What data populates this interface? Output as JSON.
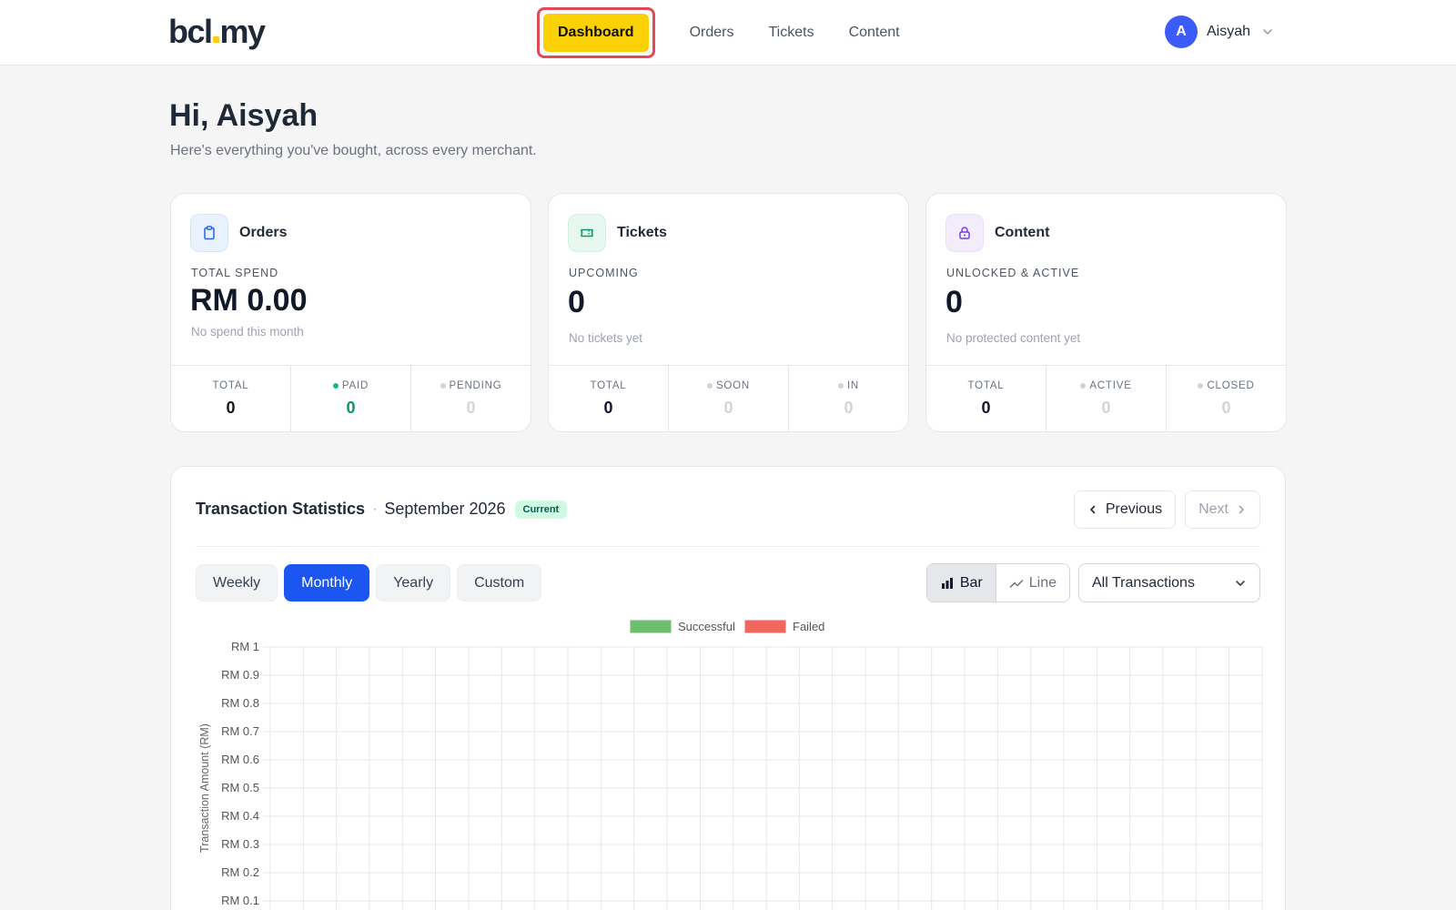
{
  "brand": {
    "logo_left": "bcl",
    "logo_right": "my"
  },
  "nav": {
    "items": [
      "Dashboard",
      "Orders",
      "Tickets",
      "Content"
    ],
    "active": "Dashboard"
  },
  "user": {
    "initial": "A",
    "name": "Aisyah"
  },
  "greeting": {
    "title": "Hi, Aisyah",
    "subtitle": "Here's everything you've bought, across every merchant."
  },
  "cards": [
    {
      "title": "Orders",
      "icon": "clipboard-icon",
      "label": "TOTAL SPEND",
      "value": "RM 0.00",
      "sub": "No spend this month",
      "stats": [
        {
          "label": "TOTAL",
          "value": "0",
          "dot": null
        },
        {
          "label": "PAID",
          "value": "0",
          "dot": "#10b981"
        },
        {
          "label": "PENDING",
          "value": "0",
          "dot": "#d1d5db"
        }
      ]
    },
    {
      "title": "Tickets",
      "icon": "ticket-icon",
      "label": "UPCOMING",
      "value": "0",
      "sub": "No tickets yet",
      "stats": [
        {
          "label": "TOTAL",
          "value": "0",
          "dot": null
        },
        {
          "label": "SOON",
          "value": "0",
          "dot": "#d1d5db"
        },
        {
          "label": "IN",
          "value": "0",
          "dot": "#d1d5db"
        }
      ]
    },
    {
      "title": "Content",
      "icon": "lock-icon",
      "label": "UNLOCKED & ACTIVE",
      "value": "0",
      "sub": "No protected content yet",
      "stats": [
        {
          "label": "TOTAL",
          "value": "0",
          "dot": null
        },
        {
          "label": "ACTIVE",
          "value": "0",
          "dot": "#d1d5db"
        },
        {
          "label": "CLOSED",
          "value": "0",
          "dot": "#d1d5db"
        }
      ]
    }
  ],
  "transactions": {
    "title": "Transaction Statistics",
    "separator": "·",
    "month": "September 2026",
    "badge": "Current",
    "previous_label": "Previous",
    "next_label": "Next",
    "periods": [
      "Weekly",
      "Monthly",
      "Yearly",
      "Custom"
    ],
    "active_period": "Monthly",
    "chart_types": [
      "Bar",
      "Line"
    ],
    "active_chart_type": "Bar",
    "filter_value": "All Transactions"
  },
  "colors": {
    "accent_yellow": "#fad104",
    "primary_blue": "#1c56f0",
    "successful": "#6dbf6f",
    "failed": "#f0675e"
  },
  "chart_data": {
    "type": "bar",
    "ylabel": "Transaction Amount (RM)",
    "ylim": [
      0,
      1
    ],
    "y_ticks": [
      "RM 1",
      "RM 0.9",
      "RM 0.8",
      "RM 0.7",
      "RM 0.6",
      "RM 0.5",
      "RM 0.4",
      "RM 0.3",
      "RM 0.2",
      "RM 0.1"
    ],
    "grid": true,
    "legend_position": "top-center",
    "series": [
      {
        "name": "Successful",
        "values": []
      },
      {
        "name": "Failed",
        "values": []
      }
    ]
  }
}
